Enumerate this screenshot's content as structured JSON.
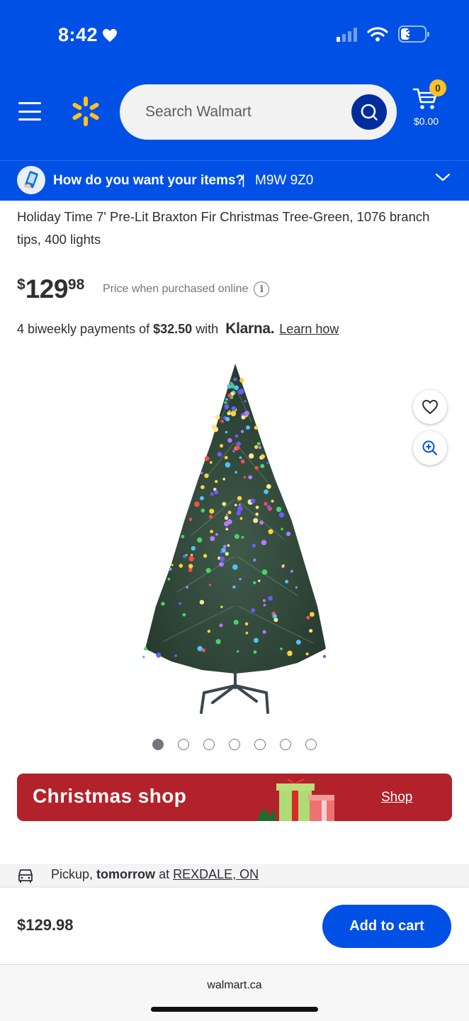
{
  "status_bar": {
    "time": "8:42",
    "battery": "35",
    "battery_level": 0.35
  },
  "header": {
    "search_placeholder": "Search Walmart",
    "cart_count": "0",
    "cart_total": "$0.00"
  },
  "delivery": {
    "question": "How do you want your items?",
    "separator": "|",
    "postal_code": "M9W 9Z0"
  },
  "product": {
    "title": "Holiday Time 7' Pre-Lit Braxton Fir Christmas Tree-Green, 1076 branch tips, 400 lights",
    "price_currency": "$",
    "price_dollars": "129",
    "price_cents": "98",
    "price_note": "Price when purchased online",
    "payments_prefix": "4 biweekly payments of",
    "payments_amount": "$32.50",
    "payments_with": "with",
    "klarna": "Klarna.",
    "learn_how": "Learn how",
    "image_count": 7,
    "active_image": 0
  },
  "banner": {
    "title": "Christmas shop",
    "link": "Shop"
  },
  "pickup": {
    "label": "Pickup,",
    "when": "tomorrow",
    "at": "at",
    "store": "REXDALE, ON"
  },
  "footer": {
    "price": "$129.98",
    "add_to_cart": "Add to cart"
  },
  "browser": {
    "url": "walmart.ca"
  },
  "colors": {
    "brand_blue": "#0050e6",
    "dark_blue": "#002d9c",
    "spark_yellow": "#ffc220",
    "banner_red": "#b3212a"
  }
}
